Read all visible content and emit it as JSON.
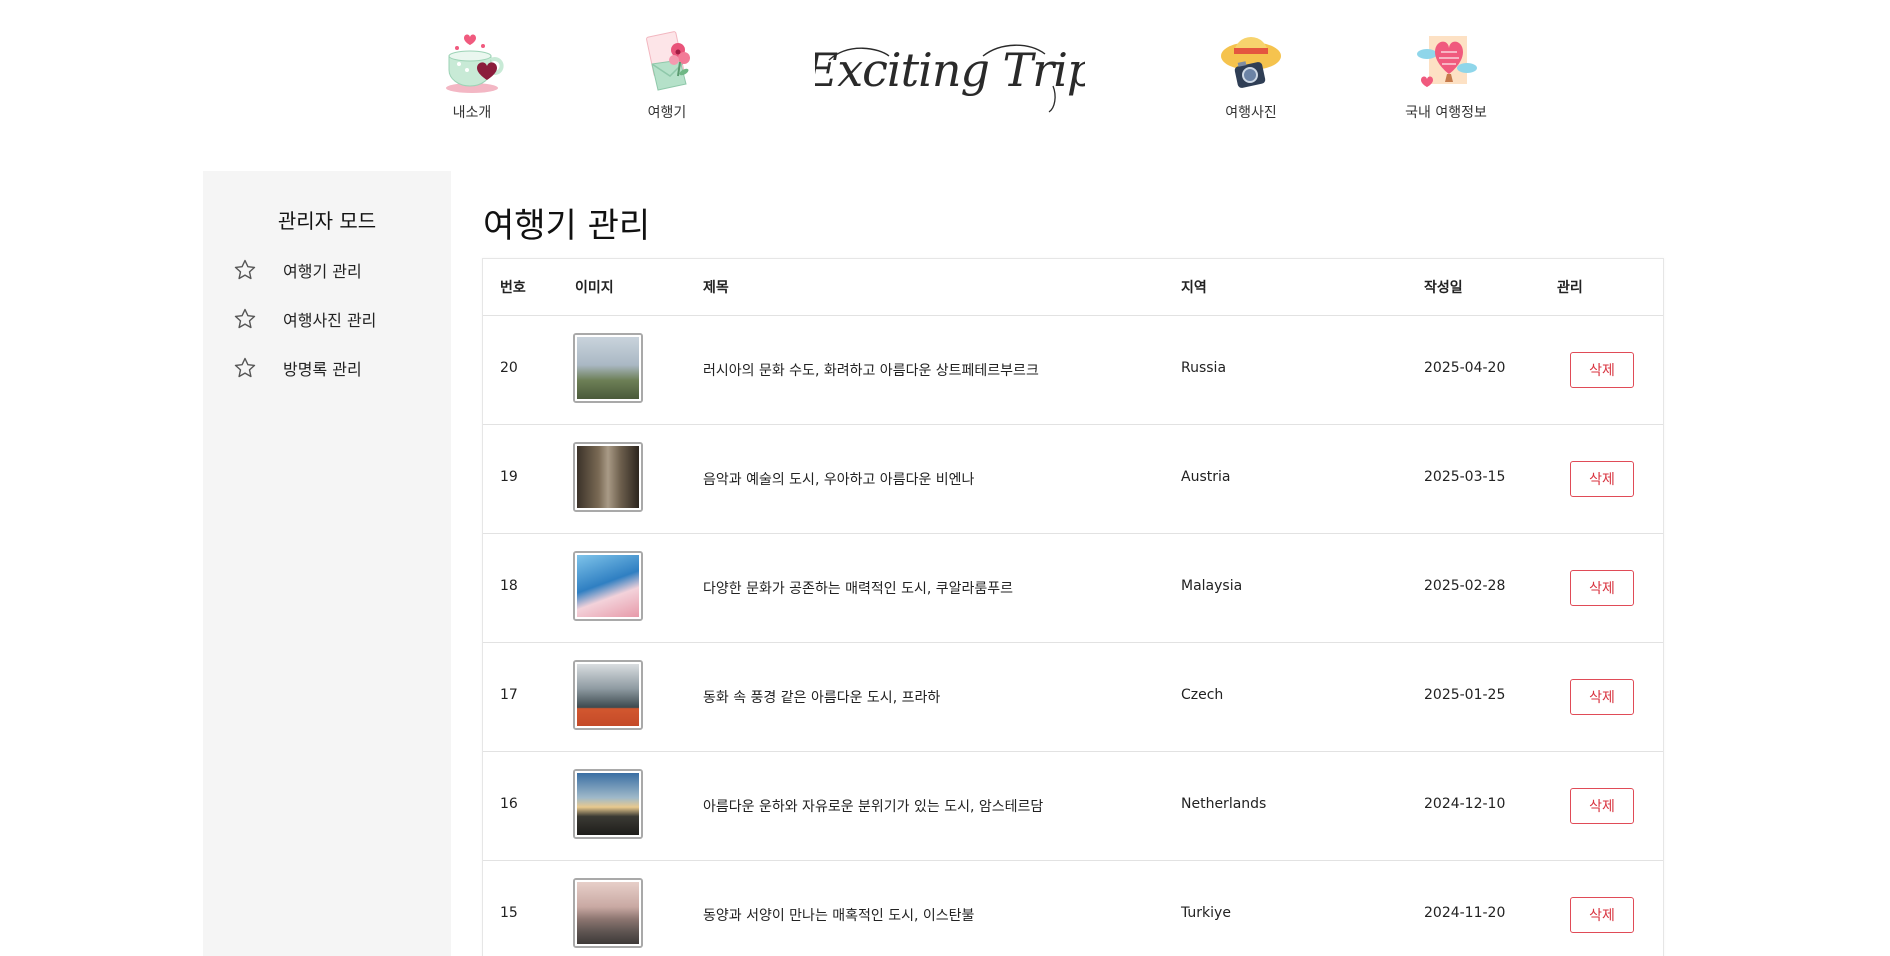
{
  "header": {
    "nav": [
      {
        "label": "내소개",
        "icon": "teacup-heart-icon"
      },
      {
        "label": "여행기",
        "icon": "letter-flower-icon"
      },
      {
        "label": "여행사진",
        "icon": "hat-camera-icon"
      },
      {
        "label": "국내 여행정보",
        "icon": "heart-balloon-icon"
      }
    ],
    "logo_text": "Exciting Trip"
  },
  "sidebar": {
    "title": "관리자 모드",
    "items": [
      {
        "label": "여행기 관리",
        "icon": "star-icon"
      },
      {
        "label": "여행사진 관리",
        "icon": "star-icon"
      },
      {
        "label": "방명록 관리",
        "icon": "star-icon"
      }
    ]
  },
  "main": {
    "title": "여행기 관리",
    "columns": [
      "번호",
      "이미지",
      "제목",
      "지역",
      "작성일",
      "관리"
    ],
    "rows": [
      {
        "no": "20",
        "title": "러시아의 문화 수도, 화려하고 아름다운 상트페테르부르크",
        "region": "Russia",
        "date": "2025-04-20",
        "action": "삭제"
      },
      {
        "no": "19",
        "title": "음악과 예술의 도시, 우아하고 아름다운 비엔나",
        "region": "Austria",
        "date": "2025-03-15",
        "action": "삭제"
      },
      {
        "no": "18",
        "title": "다양한 문화가 공존하는 매력적인 도시, 쿠알라룸푸르",
        "region": "Malaysia",
        "date": "2025-02-28",
        "action": "삭제"
      },
      {
        "no": "17",
        "title": "동화 속 풍경 같은 아름다운 도시, 프라하",
        "region": "Czech",
        "date": "2025-01-25",
        "action": "삭제"
      },
      {
        "no": "16",
        "title": "아름다운 운하와 자유로운 분위기가 있는 도시, 암스테르담",
        "region": "Netherlands",
        "date": "2024-12-10",
        "action": "삭제"
      },
      {
        "no": "15",
        "title": "동양과 서양이 만나는 매혹적인 도시, 이스탄불",
        "region": "Turkiye",
        "date": "2024-11-20",
        "action": "삭제"
      }
    ]
  },
  "colors": {
    "sidebar_bg": "#f5f5f5",
    "delete_red": "#d8333f",
    "border": "#e2e2e2"
  }
}
